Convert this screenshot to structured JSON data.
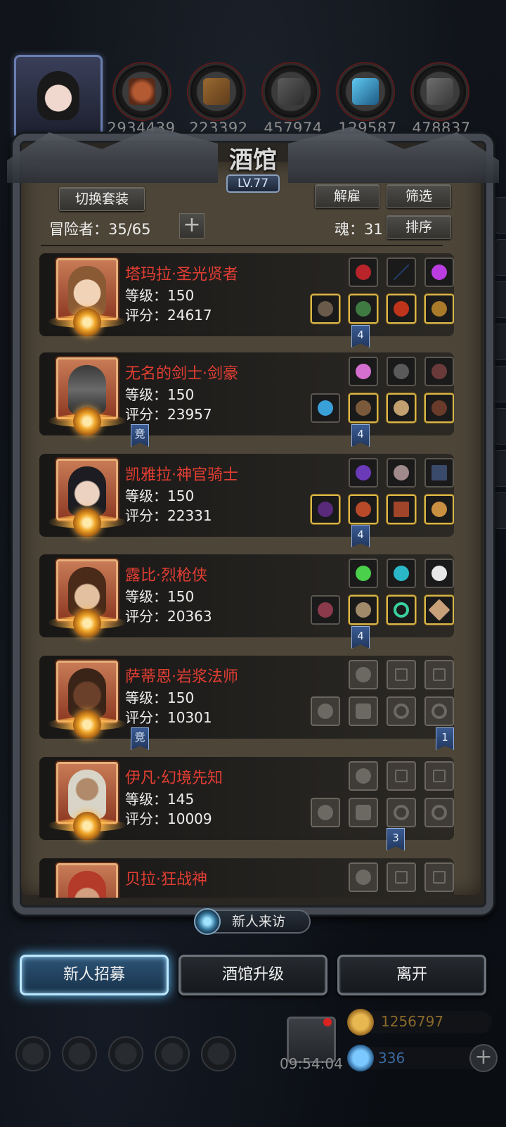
{
  "resources": [
    {
      "icon": "meat-icon",
      "value": "2934439"
    },
    {
      "icon": "wood-icon",
      "value": "223392"
    },
    {
      "icon": "stone-icon",
      "value": "457974"
    },
    {
      "icon": "crystal-icon",
      "value": "129587"
    },
    {
      "icon": "iron-icon",
      "value": "478837"
    }
  ],
  "tavern": {
    "title": "酒馆",
    "level": "LV.77",
    "switch_outfit": "切换套装",
    "dismiss": "解雇",
    "filter": "筛选",
    "sort": "排序",
    "adventurers_label": "冒险者：35/65",
    "soul_label": "魂：31"
  },
  "heroes": [
    {
      "name": "塔玛拉·圣光贤者",
      "level": "等级：150",
      "score": "评分：24617",
      "top_tag": "",
      "bottom_left_tag": "",
      "bottom_right_tag": "4"
    },
    {
      "name": "无名的剑士·剑豪",
      "level": "等级：150",
      "score": "评分：23957",
      "bottom_left_tag": "竞",
      "bottom_right_tag": "4"
    },
    {
      "name": "凯雅拉·神官骑士",
      "level": "等级：150",
      "score": "评分：22331",
      "bottom_left_tag": "",
      "bottom_right_tag": "4"
    },
    {
      "name": "露比·烈枪侠",
      "level": "等级：150",
      "score": "评分：20363",
      "bottom_left_tag": "",
      "bottom_right_tag": "4"
    },
    {
      "name": "萨蒂恩·岩浆法师",
      "level": "等级：150",
      "score": "评分：10301",
      "bottom_left_tag": "竞",
      "bottom_right_tag": "1"
    },
    {
      "name": "伊凡·幻境先知",
      "level": "等级：145",
      "score": "评分：10009",
      "bottom_left_tag": "",
      "bottom_right_tag": "3"
    },
    {
      "name": "贝拉·狂战神",
      "level": "",
      "score": "",
      "bottom_left_tag": "",
      "bottom_right_tag": ""
    }
  ],
  "visitor": {
    "label": "新人来访"
  },
  "actions": {
    "recruit": "新人招募",
    "upgrade": "酒馆升级",
    "leave": "离开"
  },
  "footer": {
    "timer": "09:54:04",
    "gold": "1256797",
    "gems": "336",
    "add": "+"
  },
  "colors": {
    "hero_name": "#e33e33",
    "accent_blue": "#5ec3ff",
    "gold_frame": "#d8b64a"
  }
}
